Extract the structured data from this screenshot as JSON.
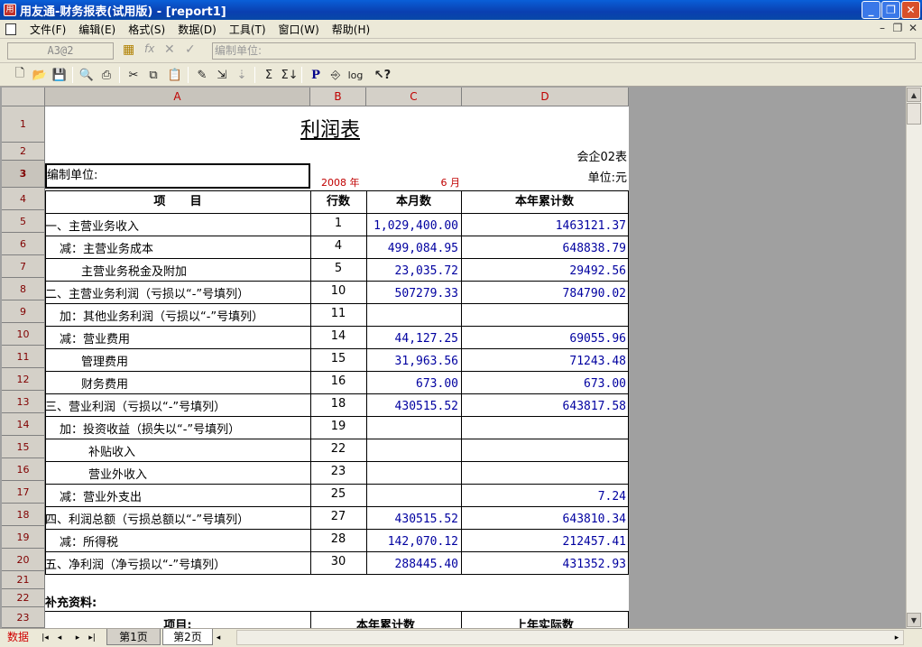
{
  "window": {
    "title": "用友通-财务报表(试用版) - [report1]",
    "minimize": "_",
    "restore": "❐",
    "close": "✕"
  },
  "menu": [
    "文件(F)",
    "编辑(E)",
    "格式(S)",
    "数据(D)",
    "工具(T)",
    "窗口(W)",
    "帮助(H)"
  ],
  "mdi_controls": [
    "–",
    "❐",
    "✕"
  ],
  "formula_bar": {
    "cell_ref": "A3@2",
    "fx_label": "fx",
    "input_value": "编制单位:"
  },
  "toolbar_icons": [
    "new-icon",
    "open-icon",
    "save-icon",
    "print-preview-icon",
    "print-icon",
    "cut-icon",
    "copy-icon",
    "paste-icon",
    "format-icon",
    "insert-icon",
    "sort-icon",
    "sum-icon",
    "subtotal-icon",
    "param-icon",
    "export-icon",
    "log-icon",
    "help-icon"
  ],
  "columns": [
    "A",
    "B",
    "C",
    "D"
  ],
  "rows": [
    "1",
    "2",
    "3",
    "4",
    "5",
    "6",
    "7",
    "8",
    "9",
    "10",
    "11",
    "12",
    "13",
    "14",
    "15",
    "16",
    "17",
    "18",
    "19",
    "20",
    "21",
    "22",
    "23"
  ],
  "report": {
    "title": "利润表",
    "form_code": "会企02表",
    "unit_label": "编制单位:",
    "year": "2008 年",
    "month": "6 月",
    "currency": "单位:元",
    "headers": [
      "项      目",
      "行数",
      "本月数",
      "本年累计数"
    ],
    "lines": [
      {
        "item": "一、主营业务收入",
        "indent": 0,
        "line": "1",
        "month": "1,029,400.00",
        "ytd": "1463121.37"
      },
      {
        "item": "减：主营业务成本",
        "indent": 1,
        "line": "4",
        "month": "499,084.95",
        "ytd": "648838.79"
      },
      {
        "item": "主营业务税金及附加",
        "indent": 3,
        "line": "5",
        "month": "23,035.72",
        "ytd": "29492.56"
      },
      {
        "item": "二、主营业务利润（亏损以“-”号填列）",
        "indent": 0,
        "line": "10",
        "month": "507279.33",
        "ytd": "784790.02"
      },
      {
        "item": "加：其他业务利润（亏损以“-”号填列）",
        "indent": 1,
        "line": "11",
        "month": "",
        "ytd": ""
      },
      {
        "item": "减：营业费用",
        "indent": 1,
        "line": "14",
        "month": "44,127.25",
        "ytd": "69055.96"
      },
      {
        "item": "管理费用",
        "indent": 3,
        "line": "15",
        "month": "31,963.56",
        "ytd": "71243.48"
      },
      {
        "item": "财务费用",
        "indent": 3,
        "line": "16",
        "month": "673.00",
        "ytd": "673.00"
      },
      {
        "item": "三、营业利润（亏损以“-”号填列）",
        "indent": 0,
        "line": "18",
        "month": "430515.52",
        "ytd": "643817.58"
      },
      {
        "item": "加：投资收益（损失以“-”号填列）",
        "indent": 1,
        "line": "19",
        "month": "",
        "ytd": ""
      },
      {
        "item": "补贴收入",
        "indent": 2,
        "line": "22",
        "month": "",
        "ytd": ""
      },
      {
        "item": "营业外收入",
        "indent": 2,
        "line": "23",
        "month": "",
        "ytd": ""
      },
      {
        "item": "减：营业外支出",
        "indent": 1,
        "line": "25",
        "month": "",
        "ytd": "7.24"
      },
      {
        "item": "四、利润总额（亏损总额以“-”号填列）",
        "indent": 0,
        "line": "27",
        "month": "430515.52",
        "ytd": "643810.34"
      },
      {
        "item": "减：所得税",
        "indent": 1,
        "line": "28",
        "month": "142,070.12",
        "ytd": "212457.41"
      },
      {
        "item": "五、净利润（净亏损以“-”号填列）",
        "indent": 0,
        "line": "30",
        "month": "288445.40",
        "ytd": "431352.93"
      }
    ],
    "supplement_title": "补充资料:",
    "supplement_headers": [
      "项目:",
      "本年累计数",
      "上年实际数"
    ]
  },
  "status": {
    "mode": "数据",
    "nav": [
      "|◂",
      "◂",
      "▸",
      "▸|"
    ],
    "tabs": [
      "第1页",
      "第2页"
    ],
    "active_tab": 1
  },
  "colors": {
    "title_bar": "#0a4fc8",
    "header_text": "#c00000",
    "number_text": "#0000a0",
    "mode_text": "#d00000"
  }
}
